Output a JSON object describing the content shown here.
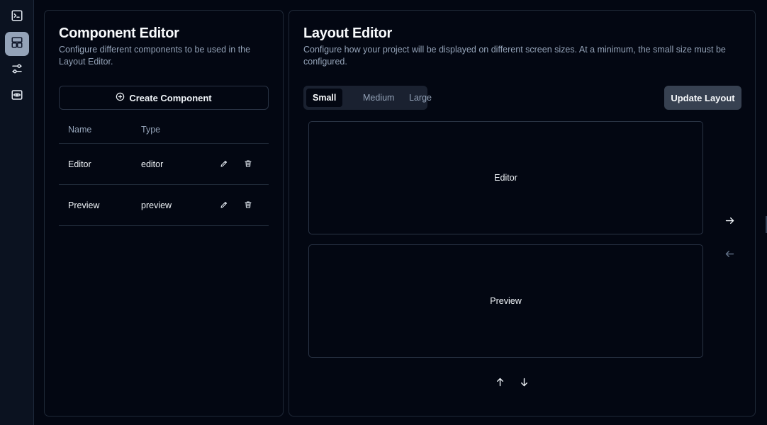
{
  "sidebar": {
    "items": [
      {
        "icon": "terminal-icon",
        "active": false
      },
      {
        "icon": "layout-icon",
        "active": true
      },
      {
        "icon": "sliders-icon",
        "active": false
      },
      {
        "icon": "eye-icon",
        "active": false
      }
    ]
  },
  "component_editor": {
    "title": "Component Editor",
    "description": "Configure different components to be used in the Layout Editor.",
    "create_button": "Create Component",
    "columns": [
      "Name",
      "Type"
    ],
    "rows": [
      {
        "name": "Editor",
        "type": "editor"
      },
      {
        "name": "Preview",
        "type": "preview"
      }
    ]
  },
  "layout_editor": {
    "title": "Layout Editor",
    "description": "Configure how your project will be displayed on different screen sizes. At a minimum, the small size must be configured.",
    "tabs": [
      "Small",
      "Medium",
      "Large"
    ],
    "active_tab": "Small",
    "update_button": "Update Layout",
    "boxes": [
      "Editor",
      "Preview"
    ]
  },
  "colors": {
    "background": "#030712",
    "accent_active": "#94a3b8",
    "button_secondary": "#374151"
  }
}
